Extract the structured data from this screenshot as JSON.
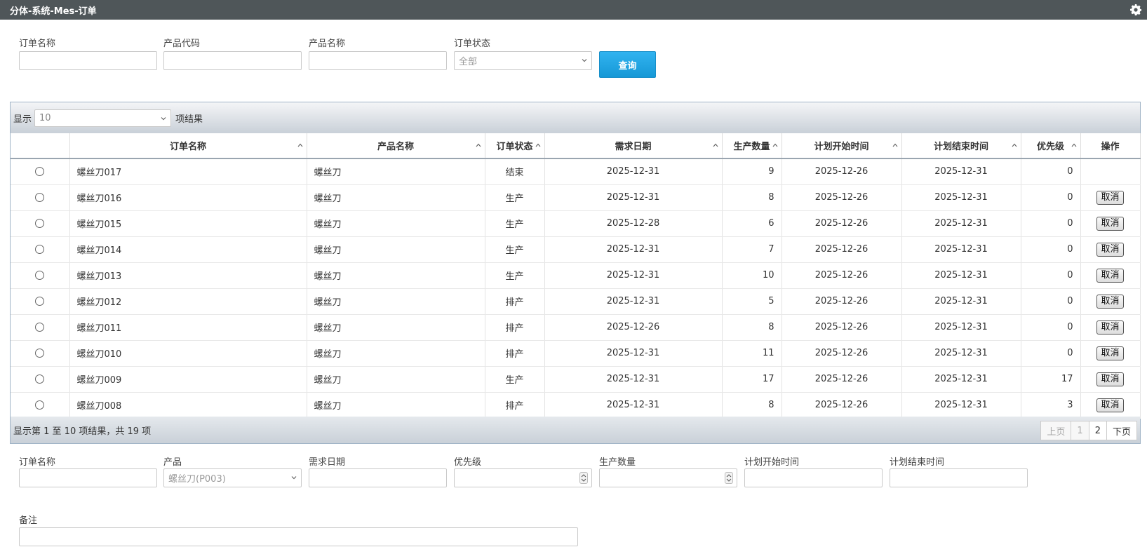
{
  "title": "分体-系统-Mes-订单",
  "icons": {
    "settings": "gear-icon",
    "select_arrow": "chevron-down-icon",
    "sort": "sort-caret-icon"
  },
  "search": {
    "order_name_label": "订单名称",
    "product_code_label": "产品代码",
    "product_name_label": "产品名称",
    "order_status_label": "订单状态",
    "order_name_value": "",
    "product_code_value": "",
    "product_name_value": "",
    "order_status_value": "全部",
    "query_label": "查询"
  },
  "table": {
    "show_label": "显示",
    "page_size": "10",
    "items_label": "项结果",
    "columns": [
      "",
      "订单名称",
      "产品名称",
      "订单状态",
      "需求日期",
      "生产数量",
      "计划开始时间",
      "计划结束时间",
      "优先级",
      "操作"
    ],
    "rows": [
      {
        "name": "螺丝刀017",
        "product": "螺丝刀",
        "status": "结束",
        "due": "2025-12-31",
        "qty": "9",
        "start": "2025-12-26",
        "end": "2025-12-31",
        "priority": "0",
        "action": ""
      },
      {
        "name": "螺丝刀016",
        "product": "螺丝刀",
        "status": "生产",
        "due": "2025-12-31",
        "qty": "8",
        "start": "2025-12-26",
        "end": "2025-12-31",
        "priority": "0",
        "action": "取消"
      },
      {
        "name": "螺丝刀015",
        "product": "螺丝刀",
        "status": "生产",
        "due": "2025-12-28",
        "qty": "6",
        "start": "2025-12-26",
        "end": "2025-12-31",
        "priority": "0",
        "action": "取消"
      },
      {
        "name": "螺丝刀014",
        "product": "螺丝刀",
        "status": "生产",
        "due": "2025-12-31",
        "qty": "7",
        "start": "2025-12-26",
        "end": "2025-12-31",
        "priority": "0",
        "action": "取消"
      },
      {
        "name": "螺丝刀013",
        "product": "螺丝刀",
        "status": "生产",
        "due": "2025-12-31",
        "qty": "10",
        "start": "2025-12-26",
        "end": "2025-12-31",
        "priority": "0",
        "action": "取消"
      },
      {
        "name": "螺丝刀012",
        "product": "螺丝刀",
        "status": "排产",
        "due": "2025-12-31",
        "qty": "5",
        "start": "2025-12-26",
        "end": "2025-12-31",
        "priority": "0",
        "action": "取消"
      },
      {
        "name": "螺丝刀011",
        "product": "螺丝刀",
        "status": "排产",
        "due": "2025-12-26",
        "qty": "8",
        "start": "2025-12-26",
        "end": "2025-12-31",
        "priority": "0",
        "action": "取消"
      },
      {
        "name": "螺丝刀010",
        "product": "螺丝刀",
        "status": "排产",
        "due": "2025-12-31",
        "qty": "11",
        "start": "2025-12-26",
        "end": "2025-12-31",
        "priority": "0",
        "action": "取消"
      },
      {
        "name": "螺丝刀009",
        "product": "螺丝刀",
        "status": "生产",
        "due": "2025-12-31",
        "qty": "17",
        "start": "2025-12-26",
        "end": "2025-12-31",
        "priority": "17",
        "action": "取消"
      },
      {
        "name": "螺丝刀008",
        "product": "螺丝刀",
        "status": "排产",
        "due": "2025-12-31",
        "qty": "8",
        "start": "2025-12-26",
        "end": "2025-12-31",
        "priority": "3",
        "action": "取消"
      }
    ],
    "info": "显示第 1 至 10 项结果，共 19 项",
    "pager": {
      "prev": "上页",
      "page1": "1",
      "page2": "2",
      "next": "下页"
    }
  },
  "form": {
    "order_name_label": "订单名称",
    "product_label": "产品",
    "due_date_label": "需求日期",
    "priority_label": "优先级",
    "quantity_label": "生产数量",
    "plan_start_label": "计划开始时间",
    "plan_end_label": "计划结束时间",
    "remark_label": "备注",
    "product_value": "螺丝刀(P003)",
    "order_name_value": "",
    "due_date_value": "",
    "priority_value": "",
    "quantity_value": "",
    "plan_start_value": "",
    "plan_end_value": "",
    "remark_value": ""
  }
}
